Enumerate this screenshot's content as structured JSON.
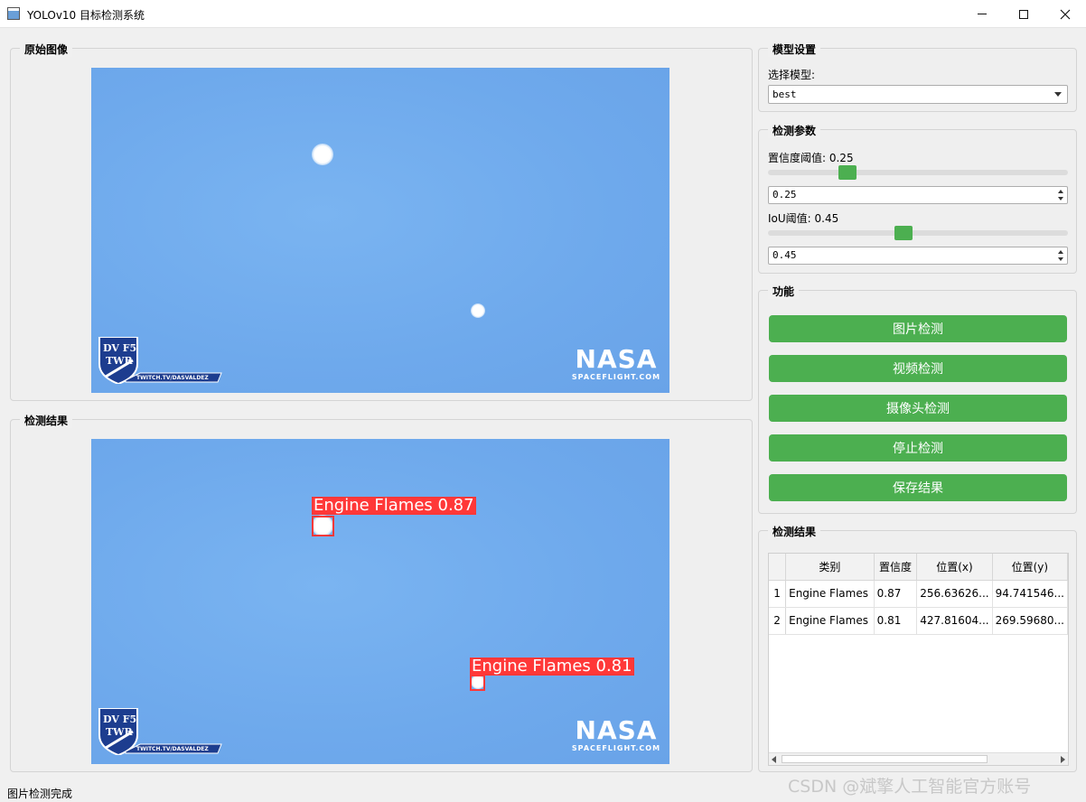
{
  "window": {
    "title": "YOLOv10 目标检测系统"
  },
  "panels": {
    "original_title": "原始图像",
    "result_title": "检测结果"
  },
  "image": {
    "watermark_left_line1": "DV F5",
    "watermark_left_line2": "TWR",
    "watermark_left_url": "TWITCH.TV/DASVALDEZ",
    "watermark_right_logo": "NASA",
    "watermark_right_sub": "SPACEFLIGHT.COM"
  },
  "detections": [
    {
      "label": "Engine Flames 0.87"
    },
    {
      "label": "Engine Flames 0.81"
    }
  ],
  "model": {
    "group_title": "模型设置",
    "select_label": "选择模型:",
    "selected": "best"
  },
  "params": {
    "group_title": "检测参数",
    "conf_label": "置信度阈值: 0.25",
    "conf_value": "0.25",
    "conf_fraction": 0.25,
    "iou_label": "IoU阈值: 0.45",
    "iou_value": "0.45",
    "iou_fraction": 0.45
  },
  "functions": {
    "group_title": "功能",
    "image_detect": "图片检测",
    "video_detect": "视频检测",
    "camera_detect": "摄像头检测",
    "stop_detect": "停止检测",
    "save_result": "保存结果"
  },
  "results_table": {
    "group_title": "检测结果",
    "headers": [
      "类别",
      "置信度",
      "位置(x)",
      "位置(y)"
    ],
    "rows": [
      {
        "index": "1",
        "cls": "Engine Flames",
        "conf": "0.87",
        "x": "256.63626...",
        "y": "94.741546..."
      },
      {
        "index": "2",
        "cls": "Engine Flames",
        "conf": "0.81",
        "x": "427.81604...",
        "y": "269.59680..."
      }
    ]
  },
  "status": {
    "text": "图片检测完成"
  },
  "page_watermark": "CSDN @斌擎人工智能官方账号",
  "colors": {
    "accent_green": "#4caf50",
    "detection_red": "#ff3838",
    "sky_blue": "#73aff0"
  }
}
